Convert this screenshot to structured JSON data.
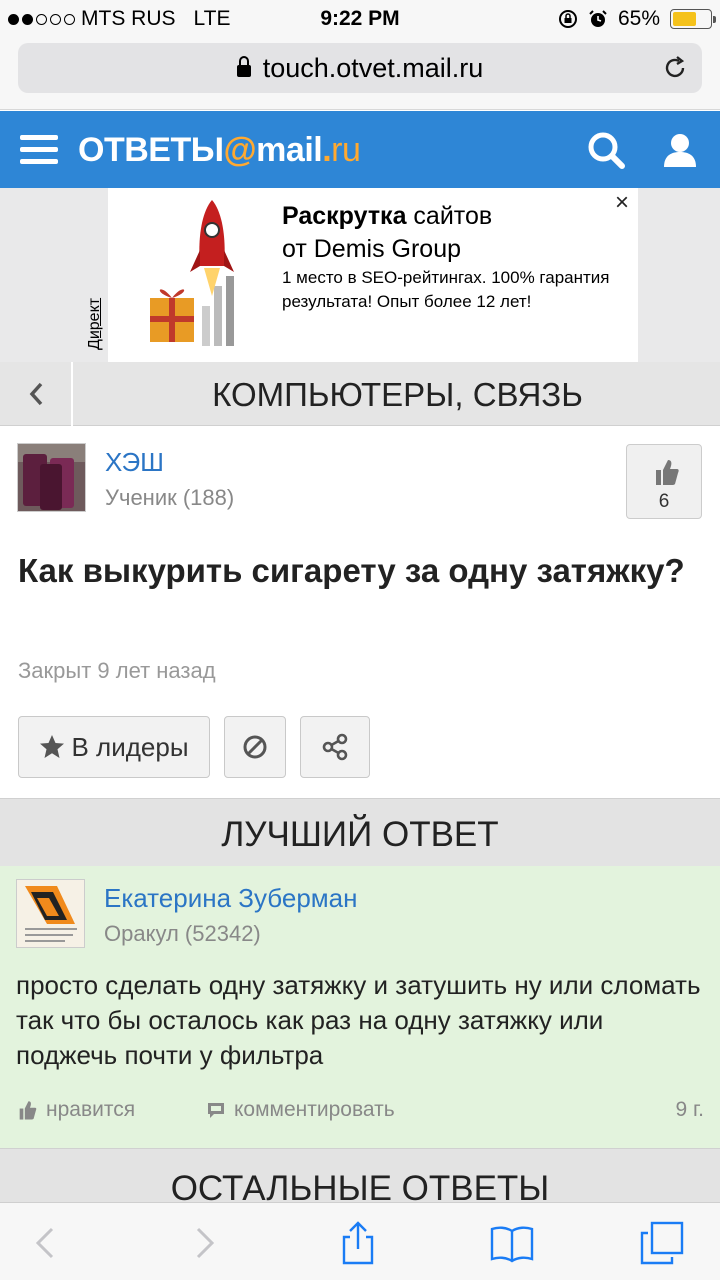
{
  "status": {
    "carrier": "MTS RUS",
    "network": "LTE",
    "time": "9:22 PM",
    "battery": "65%",
    "battery_level": 0.65
  },
  "browser": {
    "url": "touch.otvet.mail.ru"
  },
  "header": {
    "logo_main": "ОТВЕТЫ",
    "logo_at": "@",
    "logo_mail": "mail",
    "logo_dot": ".",
    "logo_ru": "ru"
  },
  "ad": {
    "label": "Директ",
    "title_bold": "Раскрутка",
    "title_rest": " сайтов",
    "title_line2": "от Demis Group",
    "text": "1 место в SEO-рейтингах. 100% гарантия результата! Опыт более 12 лет!",
    "close": "×"
  },
  "category": {
    "title": "КОМПЬЮТЕРЫ, СВЯЗЬ"
  },
  "question": {
    "author": "ХЭШ",
    "rank": "Ученик (188)",
    "likes": "6",
    "title": "Как выкурить сигарету за одну затяжку?",
    "status": "Закрыт 9 лет назад",
    "leaders_button": "В лидеры"
  },
  "best_answer": {
    "section_title": "ЛУЧШИЙ ОТВЕТ",
    "author": "Екатерина Зуберман",
    "rank": "Оракул (52342)",
    "text": "просто сделать одну затяжку и затушить ну или сломать так что бы осталось как раз на одну затяжку или поджечь почти у фильтра",
    "like_label": "нравится",
    "comment_label": "комментировать",
    "age": "9 г."
  },
  "other_answers": {
    "section_title": "ОСТАЛЬНЫЕ ОТВЕТЫ"
  },
  "colors": {
    "header_blue": "#2e86d6",
    "logo_orange": "#ffa930",
    "link_blue": "#2b75c5",
    "best_answer_bg": "#e3f3dd",
    "safari_blue": "#1a7cf5"
  }
}
